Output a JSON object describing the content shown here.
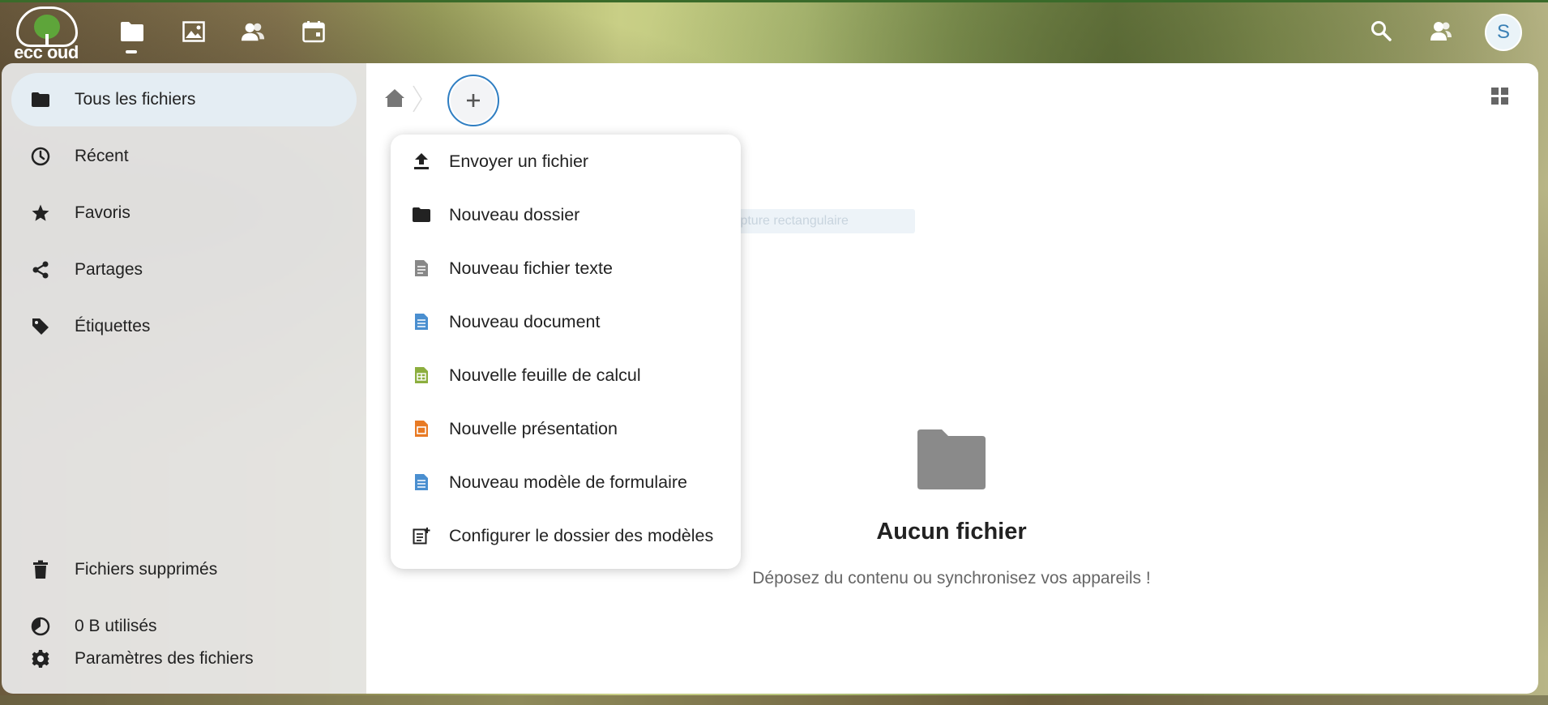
{
  "header": {
    "logo_text": "ecc oud",
    "apps": [
      {
        "name": "files-app-icon",
        "icon": "folder-icon"
      },
      {
        "name": "photos-app-icon",
        "icon": "image-icon"
      },
      {
        "name": "contacts-app-icon",
        "icon": "contacts-icon"
      },
      {
        "name": "calendar-app-icon",
        "icon": "calendar-icon"
      }
    ],
    "avatar_initial": "S"
  },
  "sidebar": {
    "items": [
      {
        "label": "Tous les fichiers",
        "icon": "folder-icon",
        "active": true
      },
      {
        "label": "Récent",
        "icon": "clock-icon"
      },
      {
        "label": "Favoris",
        "icon": "star-icon"
      },
      {
        "label": "Partages",
        "icon": "share-icon"
      },
      {
        "label": "Étiquettes",
        "icon": "tag-icon"
      }
    ],
    "bottom_items": [
      {
        "label": "Fichiers supprimés",
        "icon": "trash-icon"
      },
      {
        "label": "0 B utilisés",
        "icon": "pie-chart-icon"
      },
      {
        "label": "Paramètres des fichiers",
        "icon": "gear-icon"
      }
    ]
  },
  "new_menu": {
    "items": [
      {
        "label": "Envoyer un fichier",
        "icon": "upload-icon"
      },
      {
        "label": "Nouveau dossier",
        "icon": "folder-icon"
      },
      {
        "label": "Nouveau fichier texte",
        "icon": "text-file-icon"
      },
      {
        "label": "Nouveau document",
        "icon": "document-icon"
      },
      {
        "label": "Nouvelle feuille de calcul",
        "icon": "spreadsheet-icon"
      },
      {
        "label": "Nouvelle présentation",
        "icon": "presentation-icon"
      },
      {
        "label": "Nouveau modèle de formulaire",
        "icon": "form-template-icon"
      },
      {
        "label": "Configurer le dossier des modèles",
        "icon": "template-folder-icon"
      }
    ]
  },
  "ghost_hint": "Capture rectangulaire",
  "empty_state": {
    "title": "Aucun fichier",
    "description": "Déposez du contenu ou synchronisez vos appareils !"
  },
  "colors": {
    "accent": "#2f7ec2",
    "document": "#4a8fd0",
    "spreadsheet": "#8cae3e",
    "presentation": "#e87a24",
    "form": "#4a8fd0"
  }
}
